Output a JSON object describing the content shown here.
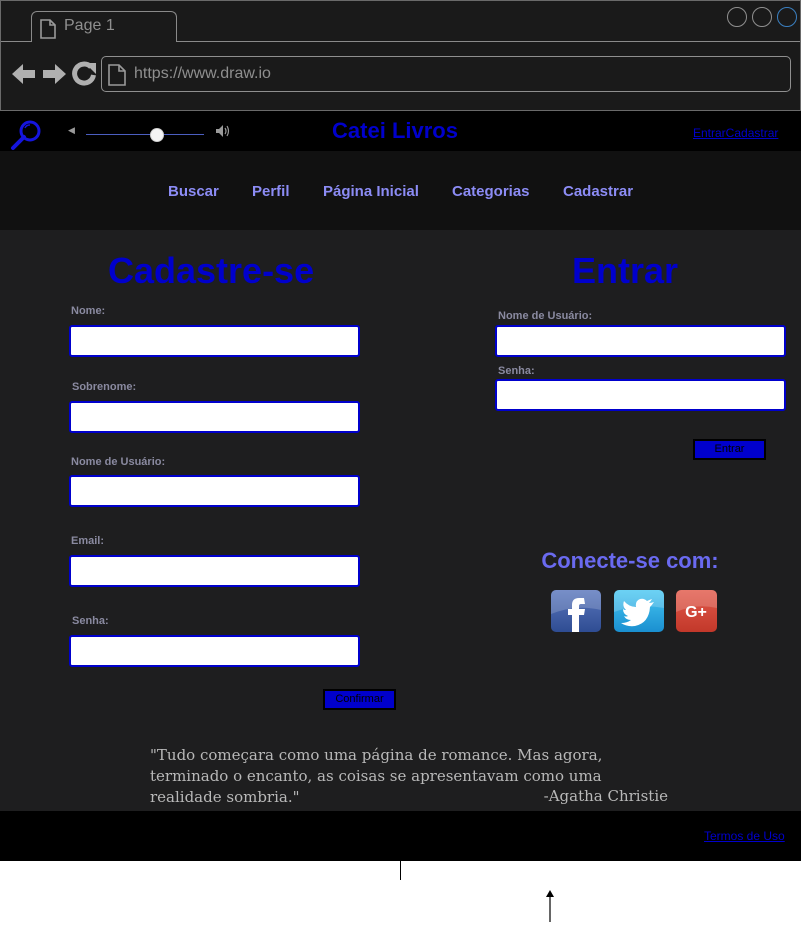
{
  "browser": {
    "tab_label": "Page 1",
    "url": "https://www.draw.io"
  },
  "header": {
    "site_title": "Catei Livros",
    "auth_link": "EntrarCadastrar"
  },
  "nav": {
    "items": [
      {
        "label": "Buscar"
      },
      {
        "label": "Perfil"
      },
      {
        "label": "Página Inicial"
      },
      {
        "label": "Categorias"
      },
      {
        "label": "Cadastrar"
      }
    ]
  },
  "register": {
    "title": "Cadastre-se",
    "fields": [
      {
        "label": "Nome:",
        "value": ""
      },
      {
        "label": "Sobrenome:",
        "value": ""
      },
      {
        "label": "Nome de Usuário:",
        "value": ""
      },
      {
        "label": "Email:",
        "value": ""
      },
      {
        "label": "Senha:",
        "value": ""
      }
    ],
    "confirm_label": "Confirmar"
  },
  "login": {
    "title": "Entrar",
    "fields": [
      {
        "label": "Nome de Usuário:",
        "value": ""
      },
      {
        "label": "Senha:",
        "value": ""
      }
    ],
    "submit_label": "Entrar"
  },
  "social": {
    "title": "Conecte-se com:",
    "icons": [
      "facebook-icon",
      "twitter-icon",
      "google-plus-icon"
    ],
    "gplus_text": "G+"
  },
  "quote": {
    "text": "\"Tudo começara como uma página de romance. Mas agora, terminado o encanto, as coisas se apresentavam como uma realidade sombria.\"",
    "author": "-Agatha Christie"
  },
  "footer": {
    "terms_link": "Termos de Uso"
  },
  "colors": {
    "accent": "#0000cc",
    "nav_text": "#8c8cf5",
    "background": "#1e1e1f"
  }
}
